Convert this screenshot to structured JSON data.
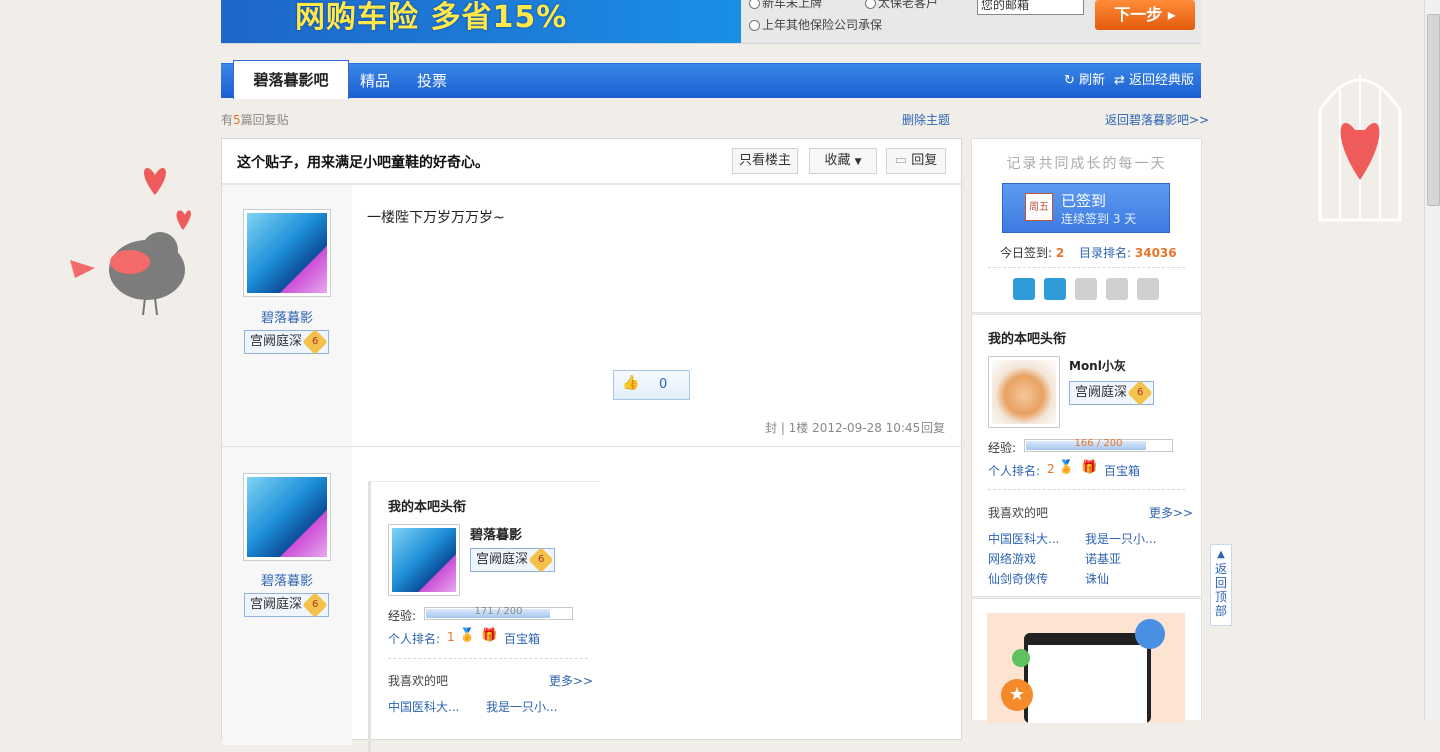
{
  "banner": {
    "promo": "网购车险 多省15%",
    "option1": "新车未上牌",
    "option2": "太保老客户",
    "option3": "上年其他保险公司承保",
    "email_value": "您的邮箱",
    "next_button": "下一步 ▸"
  },
  "nav": {
    "forum_name": "碧落暮影吧",
    "tab_featured": "精品",
    "tab_vote": "投票",
    "refresh": "刷新",
    "classic": "返回经典版"
  },
  "subheader": {
    "reply_prefix": "有",
    "reply_count": "5",
    "reply_suffix": "篇回复贴",
    "delete_topic": "删除主题",
    "back_link": "返回碧落暮影吧>>"
  },
  "post": {
    "title": "这个贴子，用来满足小吧童鞋的好奇心。",
    "only_op": "只看楼主",
    "collect": "收藏",
    "reply": "回复"
  },
  "floors": [
    {
      "author": "碧落暮影",
      "badge": "宫阙庭深",
      "level": "6",
      "content": "一楼陛下万岁万万岁~",
      "likes": "0",
      "meta": "封 | 1楼 2012-09-28 10:45",
      "reply": "回复"
    },
    {
      "author": "碧落暮影",
      "badge": "宫阙庭深",
      "level": "6",
      "card": {
        "heading": "我的本吧头衔",
        "name": "碧落暮影",
        "badge": "宫阙庭深",
        "level": "6",
        "exp_label": "经验:",
        "exp_text": "171 / 200",
        "exp_fraction": 0.855,
        "rank_label": "个人排名:",
        "rank": "1",
        "treasure": "百宝箱",
        "liked_heading": "我喜欢的吧",
        "more": "更多>>",
        "liked": [
          "中国医科大...",
          "我是一只小..."
        ]
      }
    }
  ],
  "sidebar": {
    "slogan": "记录共同成长的每一天",
    "signed": "已签到",
    "streak": "连续签到 3 天",
    "calendar": "周五",
    "today_label": "今日签到:",
    "today_count": "2",
    "rank_label": "目录排名:",
    "rank_value": "34036",
    "title_heading": "我的本吧头衔",
    "user": "Monl小灰",
    "badge": "宫阙庭深",
    "level": "6",
    "exp_label": "经验:",
    "exp_text": "166 / 200",
    "exp_fraction": 0.83,
    "personal_rank_label": "个人排名:",
    "personal_rank": "2",
    "treasure": "百宝箱",
    "liked_heading": "我喜欢的吧",
    "more": "更多>>",
    "liked": [
      "中国医科大...",
      "我是一只小...",
      "网络游戏",
      "诺基亚",
      "仙剑奇侠传",
      "诛仙"
    ]
  },
  "back_to_top": "返回顶部",
  "colors": {
    "nav_blue": "#1b5fd2",
    "link": "#2d64b3",
    "accent_orange": "#e8752a"
  }
}
